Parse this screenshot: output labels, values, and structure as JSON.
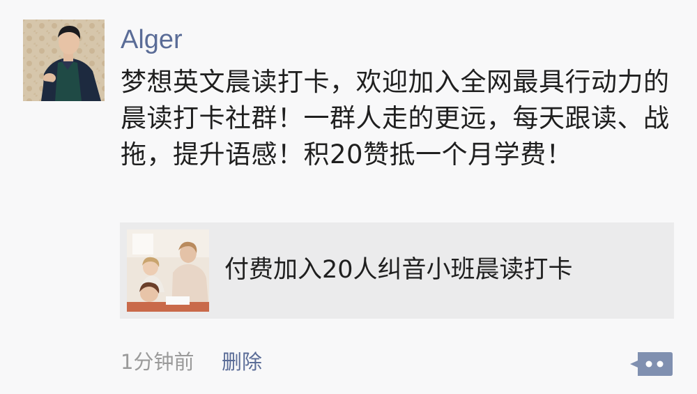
{
  "post": {
    "user_name": "Alger",
    "text": "梦想英文晨读打卡，欢迎加入全网最具行动力的晨读打卡社群！一群人走的更远，每天跟读、战拖，提升语感！积20赞抵一个月学费！",
    "link": {
      "title": "付费加入20人纠音小班晨读打卡"
    },
    "timestamp": "1分钟前",
    "delete_label": "删除",
    "more_icon": "comment-more-icon"
  },
  "colors": {
    "name_blue": "#5a6c97",
    "text": "#1f1f1f",
    "meta_gray": "#9a9a9a",
    "card_bg": "#ebebec",
    "page_bg": "#f8f8f9",
    "more_button": "#8090b0"
  }
}
